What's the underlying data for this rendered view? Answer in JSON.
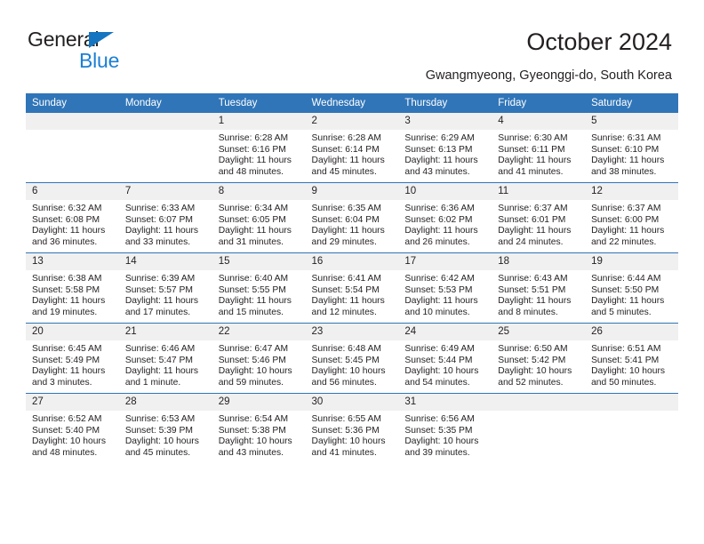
{
  "brand": {
    "name_top": "General",
    "name_bottom": "Blue",
    "triangle_color": "#1575c0",
    "blue_text_color": "#1b7fd4"
  },
  "header": {
    "title": "October 2024",
    "subtitle": "Gwangmyeong, Gyeonggi-do, South Korea",
    "header_bg_color": "#3075b8",
    "daynum_bg_color": "#f0f0f0"
  },
  "weekday_headers": [
    "Sunday",
    "Monday",
    "Tuesday",
    "Wednesday",
    "Thursday",
    "Friday",
    "Saturday"
  ],
  "labels": {
    "sunrise_prefix": "Sunrise:",
    "sunset_prefix": "Sunset:",
    "daylight_prefix": "Daylight:"
  },
  "weeks": [
    [
      {
        "day": "",
        "sunrise": "",
        "sunset": "",
        "daylight": "",
        "empty": true
      },
      {
        "day": "",
        "sunrise": "",
        "sunset": "",
        "daylight": "",
        "empty": true
      },
      {
        "day": "1",
        "sunrise": "Sunrise: 6:28 AM",
        "sunset": "Sunset: 6:16 PM",
        "daylight": "Daylight: 11 hours and 48 minutes."
      },
      {
        "day": "2",
        "sunrise": "Sunrise: 6:28 AM",
        "sunset": "Sunset: 6:14 PM",
        "daylight": "Daylight: 11 hours and 45 minutes."
      },
      {
        "day": "3",
        "sunrise": "Sunrise: 6:29 AM",
        "sunset": "Sunset: 6:13 PM",
        "daylight": "Daylight: 11 hours and 43 minutes."
      },
      {
        "day": "4",
        "sunrise": "Sunrise: 6:30 AM",
        "sunset": "Sunset: 6:11 PM",
        "daylight": "Daylight: 11 hours and 41 minutes."
      },
      {
        "day": "5",
        "sunrise": "Sunrise: 6:31 AM",
        "sunset": "Sunset: 6:10 PM",
        "daylight": "Daylight: 11 hours and 38 minutes."
      }
    ],
    [
      {
        "day": "6",
        "sunrise": "Sunrise: 6:32 AM",
        "sunset": "Sunset: 6:08 PM",
        "daylight": "Daylight: 11 hours and 36 minutes."
      },
      {
        "day": "7",
        "sunrise": "Sunrise: 6:33 AM",
        "sunset": "Sunset: 6:07 PM",
        "daylight": "Daylight: 11 hours and 33 minutes."
      },
      {
        "day": "8",
        "sunrise": "Sunrise: 6:34 AM",
        "sunset": "Sunset: 6:05 PM",
        "daylight": "Daylight: 11 hours and 31 minutes."
      },
      {
        "day": "9",
        "sunrise": "Sunrise: 6:35 AM",
        "sunset": "Sunset: 6:04 PM",
        "daylight": "Daylight: 11 hours and 29 minutes."
      },
      {
        "day": "10",
        "sunrise": "Sunrise: 6:36 AM",
        "sunset": "Sunset: 6:02 PM",
        "daylight": "Daylight: 11 hours and 26 minutes."
      },
      {
        "day": "11",
        "sunrise": "Sunrise: 6:37 AM",
        "sunset": "Sunset: 6:01 PM",
        "daylight": "Daylight: 11 hours and 24 minutes."
      },
      {
        "day": "12",
        "sunrise": "Sunrise: 6:37 AM",
        "sunset": "Sunset: 6:00 PM",
        "daylight": "Daylight: 11 hours and 22 minutes."
      }
    ],
    [
      {
        "day": "13",
        "sunrise": "Sunrise: 6:38 AM",
        "sunset": "Sunset: 5:58 PM",
        "daylight": "Daylight: 11 hours and 19 minutes."
      },
      {
        "day": "14",
        "sunrise": "Sunrise: 6:39 AM",
        "sunset": "Sunset: 5:57 PM",
        "daylight": "Daylight: 11 hours and 17 minutes."
      },
      {
        "day": "15",
        "sunrise": "Sunrise: 6:40 AM",
        "sunset": "Sunset: 5:55 PM",
        "daylight": "Daylight: 11 hours and 15 minutes."
      },
      {
        "day": "16",
        "sunrise": "Sunrise: 6:41 AM",
        "sunset": "Sunset: 5:54 PM",
        "daylight": "Daylight: 11 hours and 12 minutes."
      },
      {
        "day": "17",
        "sunrise": "Sunrise: 6:42 AM",
        "sunset": "Sunset: 5:53 PM",
        "daylight": "Daylight: 11 hours and 10 minutes."
      },
      {
        "day": "18",
        "sunrise": "Sunrise: 6:43 AM",
        "sunset": "Sunset: 5:51 PM",
        "daylight": "Daylight: 11 hours and 8 minutes."
      },
      {
        "day": "19",
        "sunrise": "Sunrise: 6:44 AM",
        "sunset": "Sunset: 5:50 PM",
        "daylight": "Daylight: 11 hours and 5 minutes."
      }
    ],
    [
      {
        "day": "20",
        "sunrise": "Sunrise: 6:45 AM",
        "sunset": "Sunset: 5:49 PM",
        "daylight": "Daylight: 11 hours and 3 minutes."
      },
      {
        "day": "21",
        "sunrise": "Sunrise: 6:46 AM",
        "sunset": "Sunset: 5:47 PM",
        "daylight": "Daylight: 11 hours and 1 minute."
      },
      {
        "day": "22",
        "sunrise": "Sunrise: 6:47 AM",
        "sunset": "Sunset: 5:46 PM",
        "daylight": "Daylight: 10 hours and 59 minutes."
      },
      {
        "day": "23",
        "sunrise": "Sunrise: 6:48 AM",
        "sunset": "Sunset: 5:45 PM",
        "daylight": "Daylight: 10 hours and 56 minutes."
      },
      {
        "day": "24",
        "sunrise": "Sunrise: 6:49 AM",
        "sunset": "Sunset: 5:44 PM",
        "daylight": "Daylight: 10 hours and 54 minutes."
      },
      {
        "day": "25",
        "sunrise": "Sunrise: 6:50 AM",
        "sunset": "Sunset: 5:42 PM",
        "daylight": "Daylight: 10 hours and 52 minutes."
      },
      {
        "day": "26",
        "sunrise": "Sunrise: 6:51 AM",
        "sunset": "Sunset: 5:41 PM",
        "daylight": "Daylight: 10 hours and 50 minutes."
      }
    ],
    [
      {
        "day": "27",
        "sunrise": "Sunrise: 6:52 AM",
        "sunset": "Sunset: 5:40 PM",
        "daylight": "Daylight: 10 hours and 48 minutes."
      },
      {
        "day": "28",
        "sunrise": "Sunrise: 6:53 AM",
        "sunset": "Sunset: 5:39 PM",
        "daylight": "Daylight: 10 hours and 45 minutes."
      },
      {
        "day": "29",
        "sunrise": "Sunrise: 6:54 AM",
        "sunset": "Sunset: 5:38 PM",
        "daylight": "Daylight: 10 hours and 43 minutes."
      },
      {
        "day": "30",
        "sunrise": "Sunrise: 6:55 AM",
        "sunset": "Sunset: 5:36 PM",
        "daylight": "Daylight: 10 hours and 41 minutes."
      },
      {
        "day": "31",
        "sunrise": "Sunrise: 6:56 AM",
        "sunset": "Sunset: 5:35 PM",
        "daylight": "Daylight: 10 hours and 39 minutes."
      },
      {
        "day": "",
        "sunrise": "",
        "sunset": "",
        "daylight": "",
        "empty": true
      },
      {
        "day": "",
        "sunrise": "",
        "sunset": "",
        "daylight": "",
        "empty": true
      }
    ]
  ]
}
